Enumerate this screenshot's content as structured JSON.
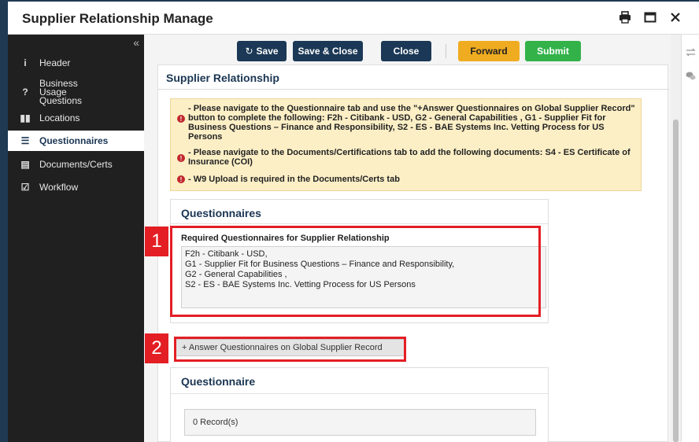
{
  "window": {
    "title": "Supplier Relationship Manage",
    "icons": [
      "printer-icon",
      "maximize-icon",
      "close-icon"
    ]
  },
  "sidebar": {
    "collapse_glyph": "«",
    "items": [
      {
        "icon": "info-icon",
        "glyph": "i",
        "label": "Header"
      },
      {
        "icon": "question-icon",
        "glyph": "?",
        "label": "Business Usage Questions"
      },
      {
        "icon": "map-icon",
        "glyph": "▮▮",
        "label": "Locations"
      },
      {
        "icon": "list-icon",
        "glyph": "☰",
        "label": "Questionnaires",
        "active": true
      },
      {
        "icon": "document-icon",
        "glyph": "▤",
        "label": "Documents/Certs"
      },
      {
        "icon": "checkbox-icon",
        "glyph": "☑",
        "label": "Workflow"
      }
    ]
  },
  "toolbar": {
    "save_label": "Save",
    "save_icon": "↻",
    "save_close_label": "Save & Close",
    "close_label": "Close",
    "forward_label": "Forward",
    "submit_label": "Submit"
  },
  "panel": {
    "title": "Supplier Relationship",
    "alerts": [
      "- Please navigate to the Questionnaire tab and use the \"+Answer Questionnaires on Global Supplier Record\" button to complete the following: F2h - Citibank - USD, G2 - General Capabilities , G1 - Supplier Fit for Business Questions – Finance and Responsibility, S2 - ES - BAE Systems Inc. Vetting Process for US Persons",
      "- Please navigate to the Documents/Certifications tab to add the following documents: S4 - ES Certificate of Insurance (COI)",
      "- W9 Upload is required in the Documents/Certs tab"
    ],
    "alert_glyph": "!",
    "questionnaires_title": "Questionnaires",
    "required_label": "Required Questionnaires for Supplier Relationship",
    "required_items": [
      "F2h - Citibank - USD,",
      "G1 - Supplier Fit for Business Questions – Finance and Responsibility,",
      "G2 - General Capabilities ,",
      "S2 - ES - BAE Systems Inc. Vetting Process for US Persons"
    ],
    "answer_button_label": "+ Answer Questionnaires on Global Supplier Record",
    "questionnaire_title": "Questionnaire",
    "records_text": "0 Record(s)"
  },
  "callouts": {
    "first": "1",
    "second": "2",
    "accent_color": "#e31e24"
  },
  "colors": {
    "navy": "#1b3856",
    "orange": "#f0ac21",
    "green": "#33b24a",
    "sidebar_bg": "#202020",
    "alert_bg": "#fcefc6"
  },
  "right_rail": {
    "icons": [
      "swap-icon",
      "chat-icon"
    ]
  }
}
